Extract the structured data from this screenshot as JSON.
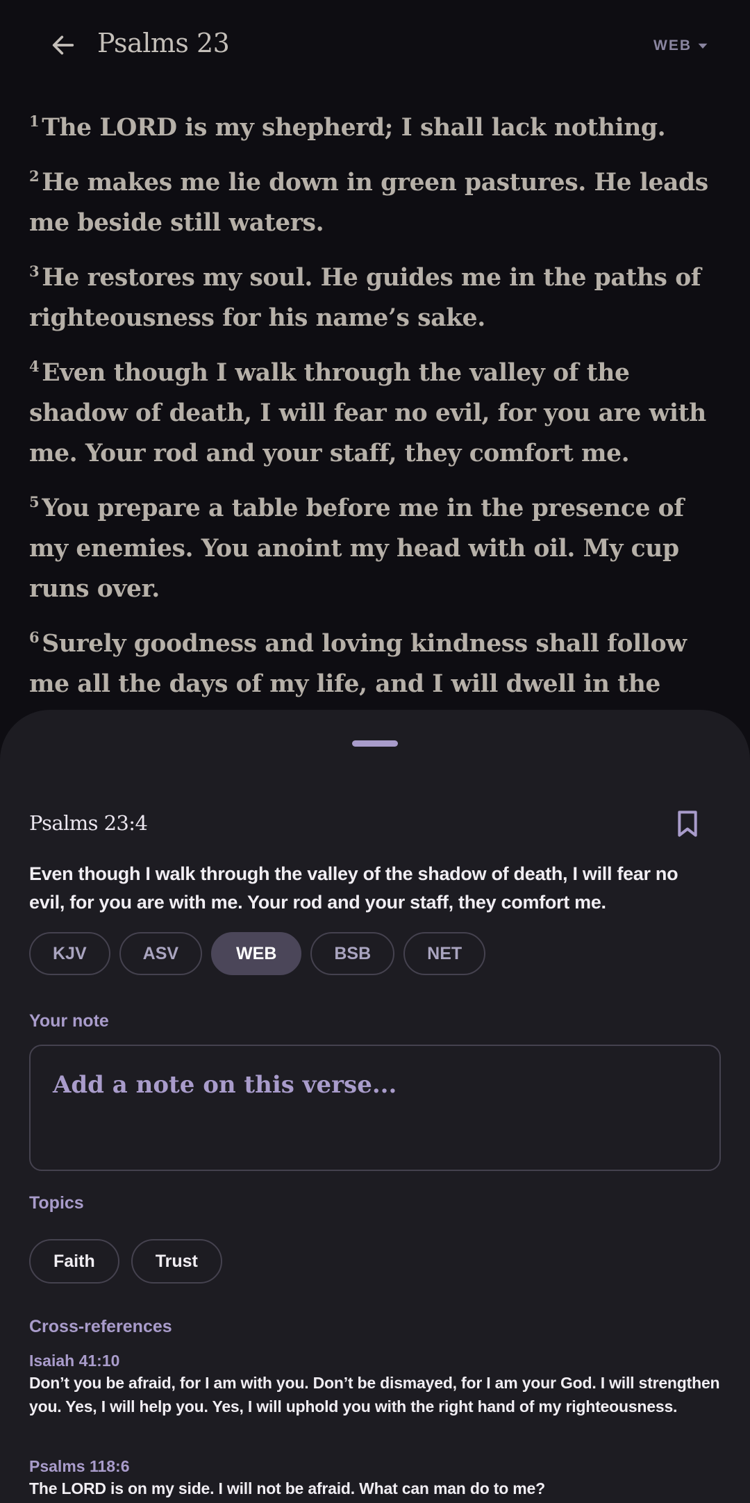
{
  "header": {
    "title": "Psalms 23",
    "version_label": "WEB",
    "back_icon": "arrow-left-icon",
    "dropdown_icon": "caret-down-icon"
  },
  "chapter": {
    "verses": [
      {
        "num": "1",
        "text": "The LORD is my shepherd; I shall lack nothing."
      },
      {
        "num": "2",
        "text": "He makes me lie down in green pastures. He leads me beside still waters."
      },
      {
        "num": "3",
        "text": "He restores my soul. He guides me in the paths of righteousness for his name’s sake."
      },
      {
        "num": "4",
        "text": "Even though I walk through the valley of the shadow of death, I will fear no evil, for you are with me. Your rod and your staff, they comfort me."
      },
      {
        "num": "5",
        "text": "You prepare a table before me in the presence of my enemies. You anoint my head with oil. My cup runs over."
      },
      {
        "num": "6",
        "text": "Surely goodness and loving kindness shall follow me all the days of my life, and I will dwell in the LORD’s house forever."
      }
    ]
  },
  "sheet": {
    "reference": "Psalms 23:4",
    "bookmark_icon": "bookmark-icon",
    "verse_text": "Even though I walk through the valley of the shadow of death, I will fear no evil, for you are with me. Your rod and your staff, they comfort me.",
    "translations": [
      "KJV",
      "ASV",
      "WEB",
      "BSB",
      "NET"
    ],
    "selected_translation": "WEB",
    "note_label": "Your note",
    "note_placeholder": "Add a note on this verse...",
    "note_value": "",
    "topics_label": "Topics",
    "topics": [
      "Faith",
      "Trust"
    ],
    "crossrefs_label": "Cross-references",
    "crossrefs": [
      {
        "ref": "Isaiah 41:10",
        "text": "Don’t you be afraid, for I am with you. Don’t be dismayed, for I am your God. I will strengthen you. Yes, I will help you. Yes, I will uphold you with the right hand of my righteousness."
      },
      {
        "ref": "Psalms 118:6",
        "text": "The LORD is on my side. I will not be afraid. What can man do to me?"
      }
    ]
  },
  "colors": {
    "background": "#0e0d12",
    "sheet": "#1d1c22",
    "accent": "#a99ccb",
    "selected_chip": "#4b4659"
  }
}
